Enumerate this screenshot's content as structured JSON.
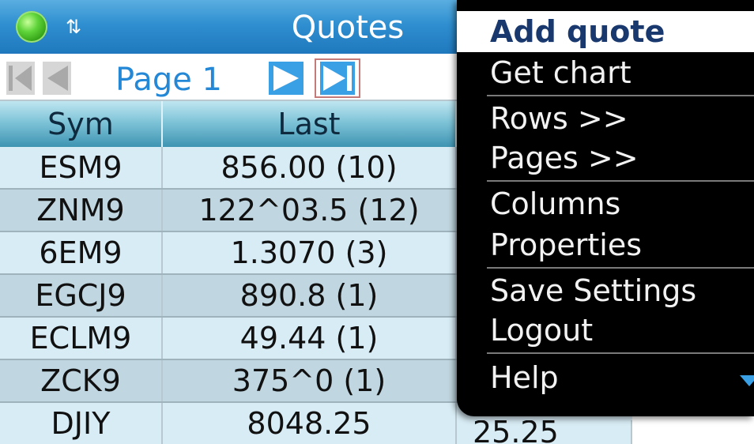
{
  "titlebar": {
    "title": "Quotes",
    "status_icon": "green-status-led",
    "signal_icon": "network-arrows-icon"
  },
  "pager": {
    "label": "Page 1"
  },
  "table": {
    "headers": [
      "Sym",
      "Last"
    ],
    "rows": [
      {
        "sym": "ESM9",
        "last": "856.00 (10)"
      },
      {
        "sym": "ZNM9",
        "last": "122^03.5 (12)"
      },
      {
        "sym": "6EM9",
        "last": "1.3070 (3)"
      },
      {
        "sym": "EGCJ9",
        "last": "890.8 (1)"
      },
      {
        "sym": "ECLM9",
        "last": "49.44 (1)"
      },
      {
        "sym": "ZCK9",
        "last": "375^0 (1)"
      },
      {
        "sym": "DJIY",
        "last": "8048.25",
        "partial": "25.25"
      }
    ]
  },
  "menu": {
    "items": [
      "Add quote",
      "Get chart",
      "Rows >>",
      "Pages >>",
      "Columns",
      "Properties",
      "Save Settings",
      "Logout",
      "Help"
    ],
    "selected": "Add quote"
  },
  "colors": {
    "accent": "#2488d6",
    "title_bar": "#2f8fd0",
    "menu_bg": "#000000",
    "header": "#7fc4d8"
  }
}
